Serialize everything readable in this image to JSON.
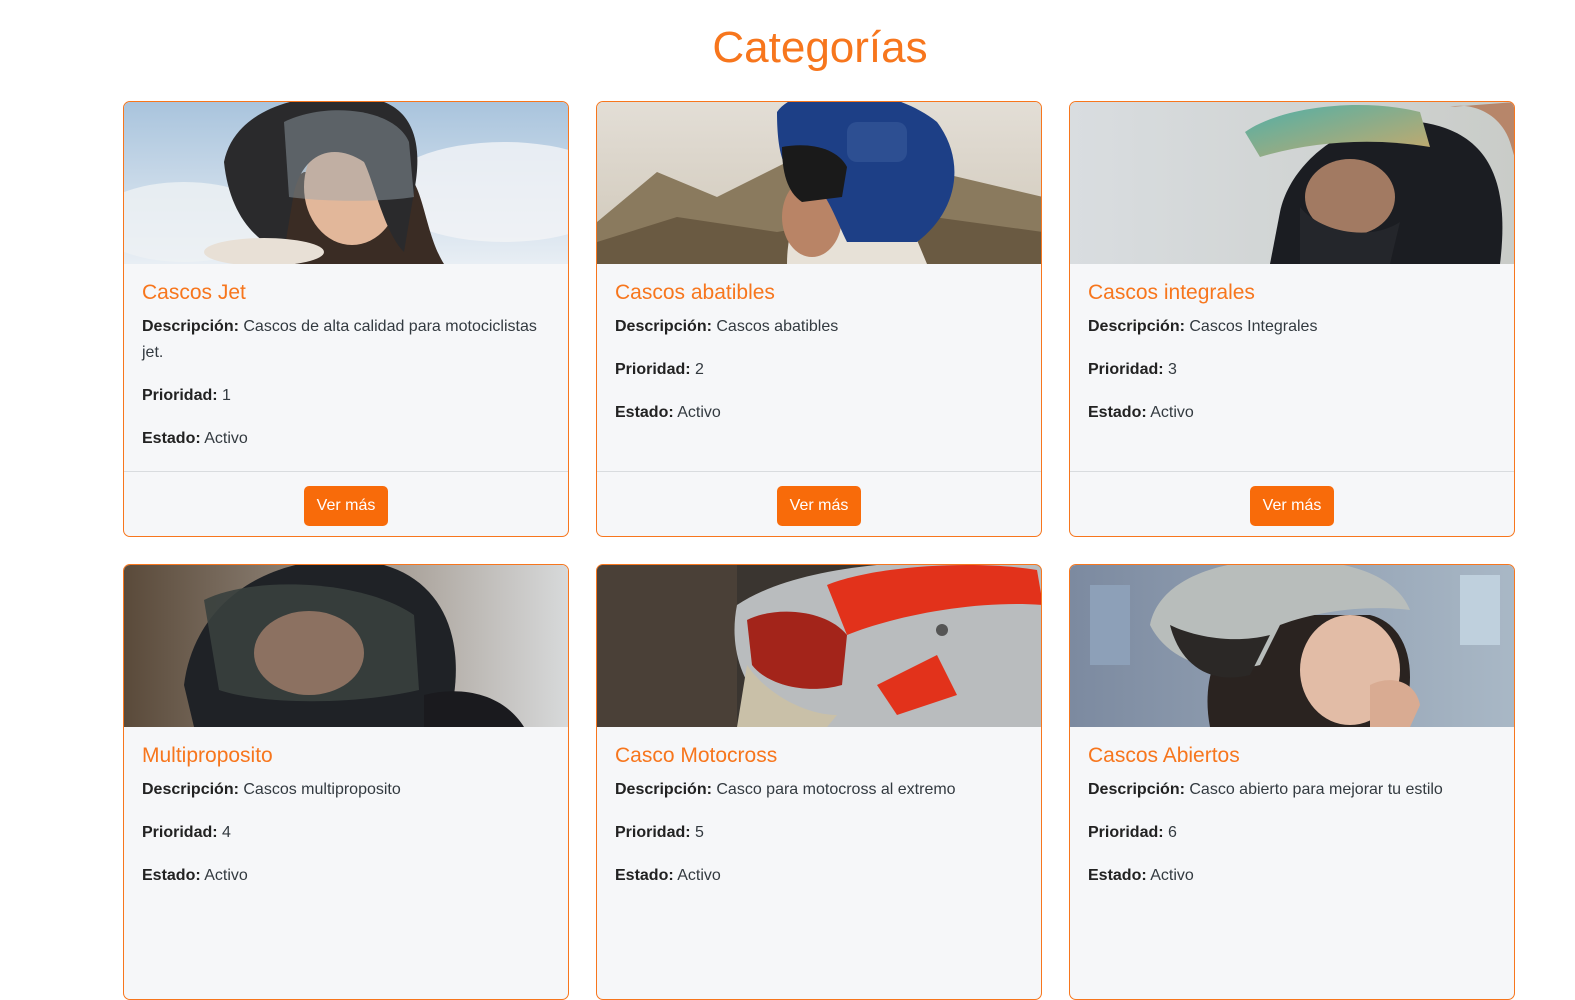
{
  "page": {
    "title": "Categorías"
  },
  "labels": {
    "description": "Descripción:",
    "priority": "Prioridad:",
    "status": "Estado:",
    "button": "Ver más"
  },
  "categories": [
    {
      "title": "Cascos Jet",
      "description": "Cascos de alta calidad para motociclistas jet.",
      "priority": "1",
      "status": "Activo",
      "image": "woman-jet-helmet-photo"
    },
    {
      "title": "Cascos abatibles",
      "description": "Cascos abatibles",
      "priority": "2",
      "status": "Activo",
      "image": "man-flip-up-helmet-photo"
    },
    {
      "title": "Cascos integrales",
      "description": "Cascos Integrales",
      "priority": "3",
      "status": "Activo",
      "image": "man-full-face-helmet-photo"
    },
    {
      "title": "Multiproposito",
      "description": "Cascos multiproposito",
      "priority": "4",
      "status": "Activo",
      "image": "man-multipurpose-helmet-photo"
    },
    {
      "title": "Casco Motocross",
      "description": "Casco para motocross al extremo",
      "priority": "5",
      "status": "Activo",
      "image": "motocross-helmet-photo"
    },
    {
      "title": "Cascos Abiertos",
      "description": "Casco abierto para mejorar tu estilo",
      "priority": "6",
      "status": "Activo",
      "image": "woman-open-helmet-photo"
    }
  ],
  "colors": {
    "accent": "#f7761d",
    "button": "#f86b0a",
    "card_bg": "#f6f7f9"
  }
}
